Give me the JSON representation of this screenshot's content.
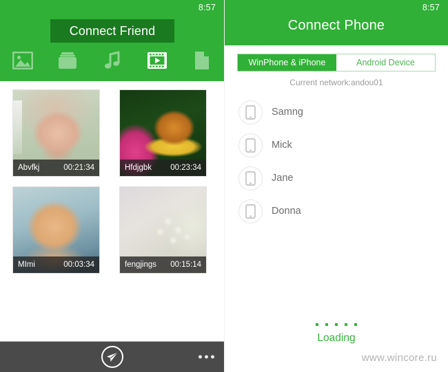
{
  "left": {
    "status_time": "8:57",
    "connect_friend_label": "Connect Friend",
    "toolbar_icons": [
      {
        "name": "photo-icon",
        "label": "Photos",
        "active": false
      },
      {
        "name": "folder-icon",
        "label": "Files",
        "active": false
      },
      {
        "name": "music-icon",
        "label": "Music",
        "active": false
      },
      {
        "name": "video-icon",
        "label": "Videos",
        "active": true
      },
      {
        "name": "document-icon",
        "label": "Documents",
        "active": false
      }
    ],
    "media_items": [
      {
        "name": "Abvfkj",
        "duration": "00:21:34"
      },
      {
        "name": "Hfdjgbk",
        "duration": "00:23:34"
      },
      {
        "name": "MImi",
        "duration": "00:03:34"
      },
      {
        "name": "fengjings",
        "duration": "00:15:14"
      }
    ],
    "bottom_bar": {
      "send_icon": "send-paper-plane-icon",
      "more_icon": "more-options-icon"
    }
  },
  "right": {
    "status_time": "8:57",
    "title": "Connect Phone",
    "tabs": [
      {
        "label": "WinPhone & iPhone",
        "active": true
      },
      {
        "label": "Android Device",
        "active": false
      }
    ],
    "network_label": "Current network:andou01",
    "devices": [
      {
        "name": "Samng"
      },
      {
        "name": "Mick"
      },
      {
        "name": "Jane"
      },
      {
        "name": "Donna"
      }
    ],
    "loading_text": "Loading",
    "loading_dot_count": 5
  },
  "watermark": "www.wincore.ru",
  "colors": {
    "brand_green": "#30b036",
    "dark_green": "#1a7a1f",
    "loading_green": "#35b53b",
    "bottom_bar": "#4a4a4a",
    "muted_text": "#9b9b9b"
  }
}
